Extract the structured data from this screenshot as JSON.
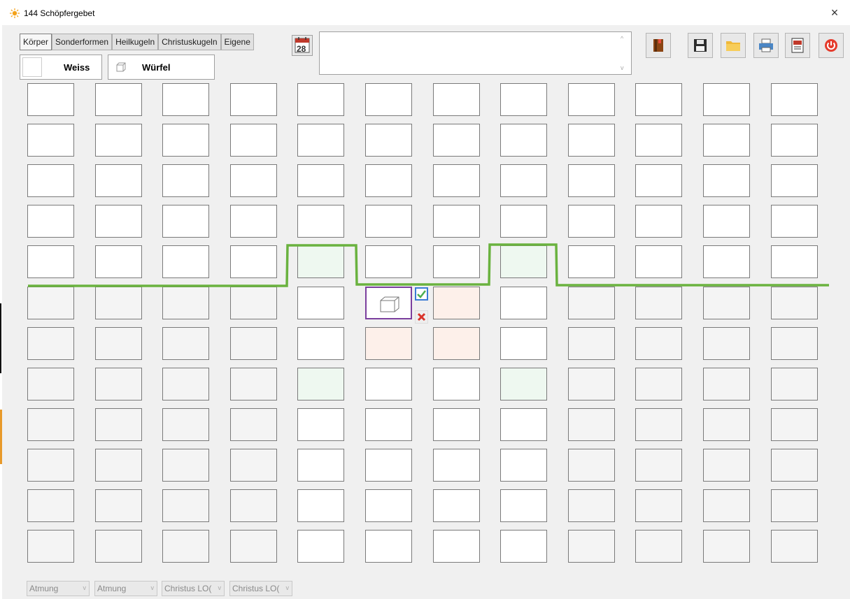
{
  "window": {
    "title": "144 Schöpfergebet",
    "close_label": "×"
  },
  "tabs": [
    {
      "label": "Körper",
      "active": true
    },
    {
      "label": "Sonderformen",
      "active": false
    },
    {
      "label": "Heilkugeln",
      "active": false
    },
    {
      "label": "Christuskugeln",
      "active": false
    },
    {
      "label": "Eigene",
      "active": false
    }
  ],
  "selection": {
    "color_label": "Weiss",
    "shape_label": "Würfel"
  },
  "calendar_button": {
    "day": "28"
  },
  "notes": {
    "value": ""
  },
  "toolbar_icons": [
    "book-icon",
    "save-icon",
    "folder-icon",
    "print-icon",
    "pdf-icon",
    "power-icon"
  ],
  "grid": {
    "rows": 12,
    "cols": 12
  },
  "popup": {
    "confirm_icon": "checkmark-icon",
    "cancel_icon": "x-icon"
  },
  "dropdowns": [
    {
      "value": "Atmung"
    },
    {
      "value": "Atmung"
    },
    {
      "value": "Christus LO("
    },
    {
      "value": "Christus LO("
    }
  ],
  "colors": {
    "path_line": "#6ab23f",
    "selected_border": "#7b3f9e",
    "green_tint": "#eef8f0",
    "peach_tint": "#fdf0ea"
  }
}
